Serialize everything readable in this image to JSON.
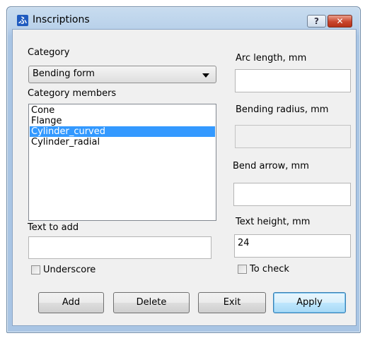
{
  "window": {
    "title": "Inscriptions"
  },
  "category": {
    "label": "Category",
    "selected": "Bending form"
  },
  "members": {
    "label": "Category members",
    "items": [
      "Cone",
      "Flange",
      "Cylinder_curved",
      "Cylinder_radial"
    ],
    "selected_index": 2
  },
  "text_to_add": {
    "label": "Text to add",
    "value": ""
  },
  "underscore": {
    "label": "Underscore",
    "checked": false
  },
  "arc_length": {
    "label": "Arc length, mm",
    "value": ""
  },
  "bending_radius": {
    "label": "Bending radius, mm",
    "value": ""
  },
  "bend_arrow": {
    "label": "Bend arrow, mm",
    "value": ""
  },
  "text_height": {
    "label": "Text height, mm",
    "value": "24"
  },
  "to_check": {
    "label": "To check",
    "checked": false
  },
  "buttons": {
    "add": "Add",
    "delete": "Delete",
    "exit": "Exit",
    "apply": "Apply"
  }
}
